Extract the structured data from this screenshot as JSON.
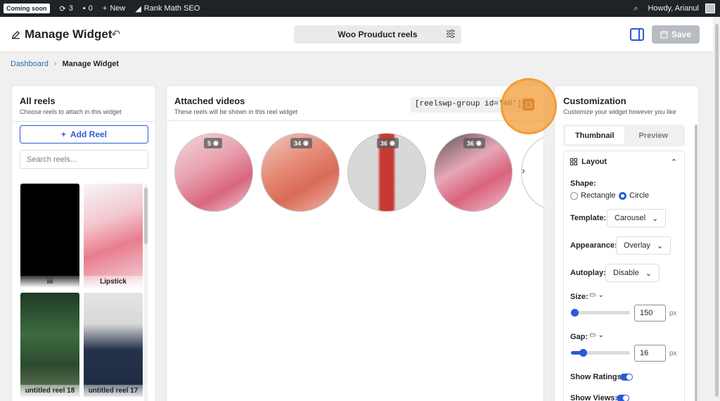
{
  "adminbar": {
    "coming_soon": "Coming soon",
    "updates_count": "3",
    "comments_count": "0",
    "new_label": "New",
    "plugin_label": "Rank Math SEO",
    "howdy": "Howdy, Arianul"
  },
  "header": {
    "title": "Manage Widget",
    "widget_name": "Woo Prouduct reels",
    "save_label": "Save"
  },
  "breadcrumb": {
    "home": "Dashboard",
    "current": "Manage Widget"
  },
  "all_reels": {
    "title": "All reels",
    "subtitle": "Choose reels to attach in this widget",
    "add_label": "Add Reel",
    "search_placeholder": "Search reels...",
    "items": [
      {
        "label": "iii"
      },
      {
        "label": "Lipstick"
      },
      {
        "label": "untitled reel 18"
      },
      {
        "label": "untitled reel 17"
      }
    ]
  },
  "attached": {
    "title": "Attached videos",
    "subtitle": "These reels will be shown in this reel widget",
    "shortcode": "[reelswp-group id='40']",
    "videos": [
      {
        "views": "5"
      },
      {
        "views": "34"
      },
      {
        "views": "36"
      },
      {
        "views": "36"
      }
    ]
  },
  "customization": {
    "title": "Customization",
    "subtitle": "Customize your widget however you like",
    "tabs": [
      "Thumbnail",
      "Preview"
    ],
    "section_title": "Layout",
    "shape_label": "Shape:",
    "shape_options": [
      "Rectangle",
      "Circle"
    ],
    "template_label": "Template:",
    "template_value": "Carousel",
    "appearance_label": "Appearance:",
    "appearance_value": "Overlay",
    "autoplay_label": "Autoplay:",
    "autoplay_value": "Disable",
    "size_label": "Size:",
    "size_value": "150",
    "size_slider": 0.05,
    "gap_label": "Gap:",
    "gap_value": "16",
    "gap_slider": 0.2,
    "unit": "px",
    "show_ratings_label": "Show Ratings:",
    "show_views_label": "Show Views:"
  },
  "colors": {
    "accent": "#2a5bd7",
    "copy_button": "#a0522d"
  }
}
